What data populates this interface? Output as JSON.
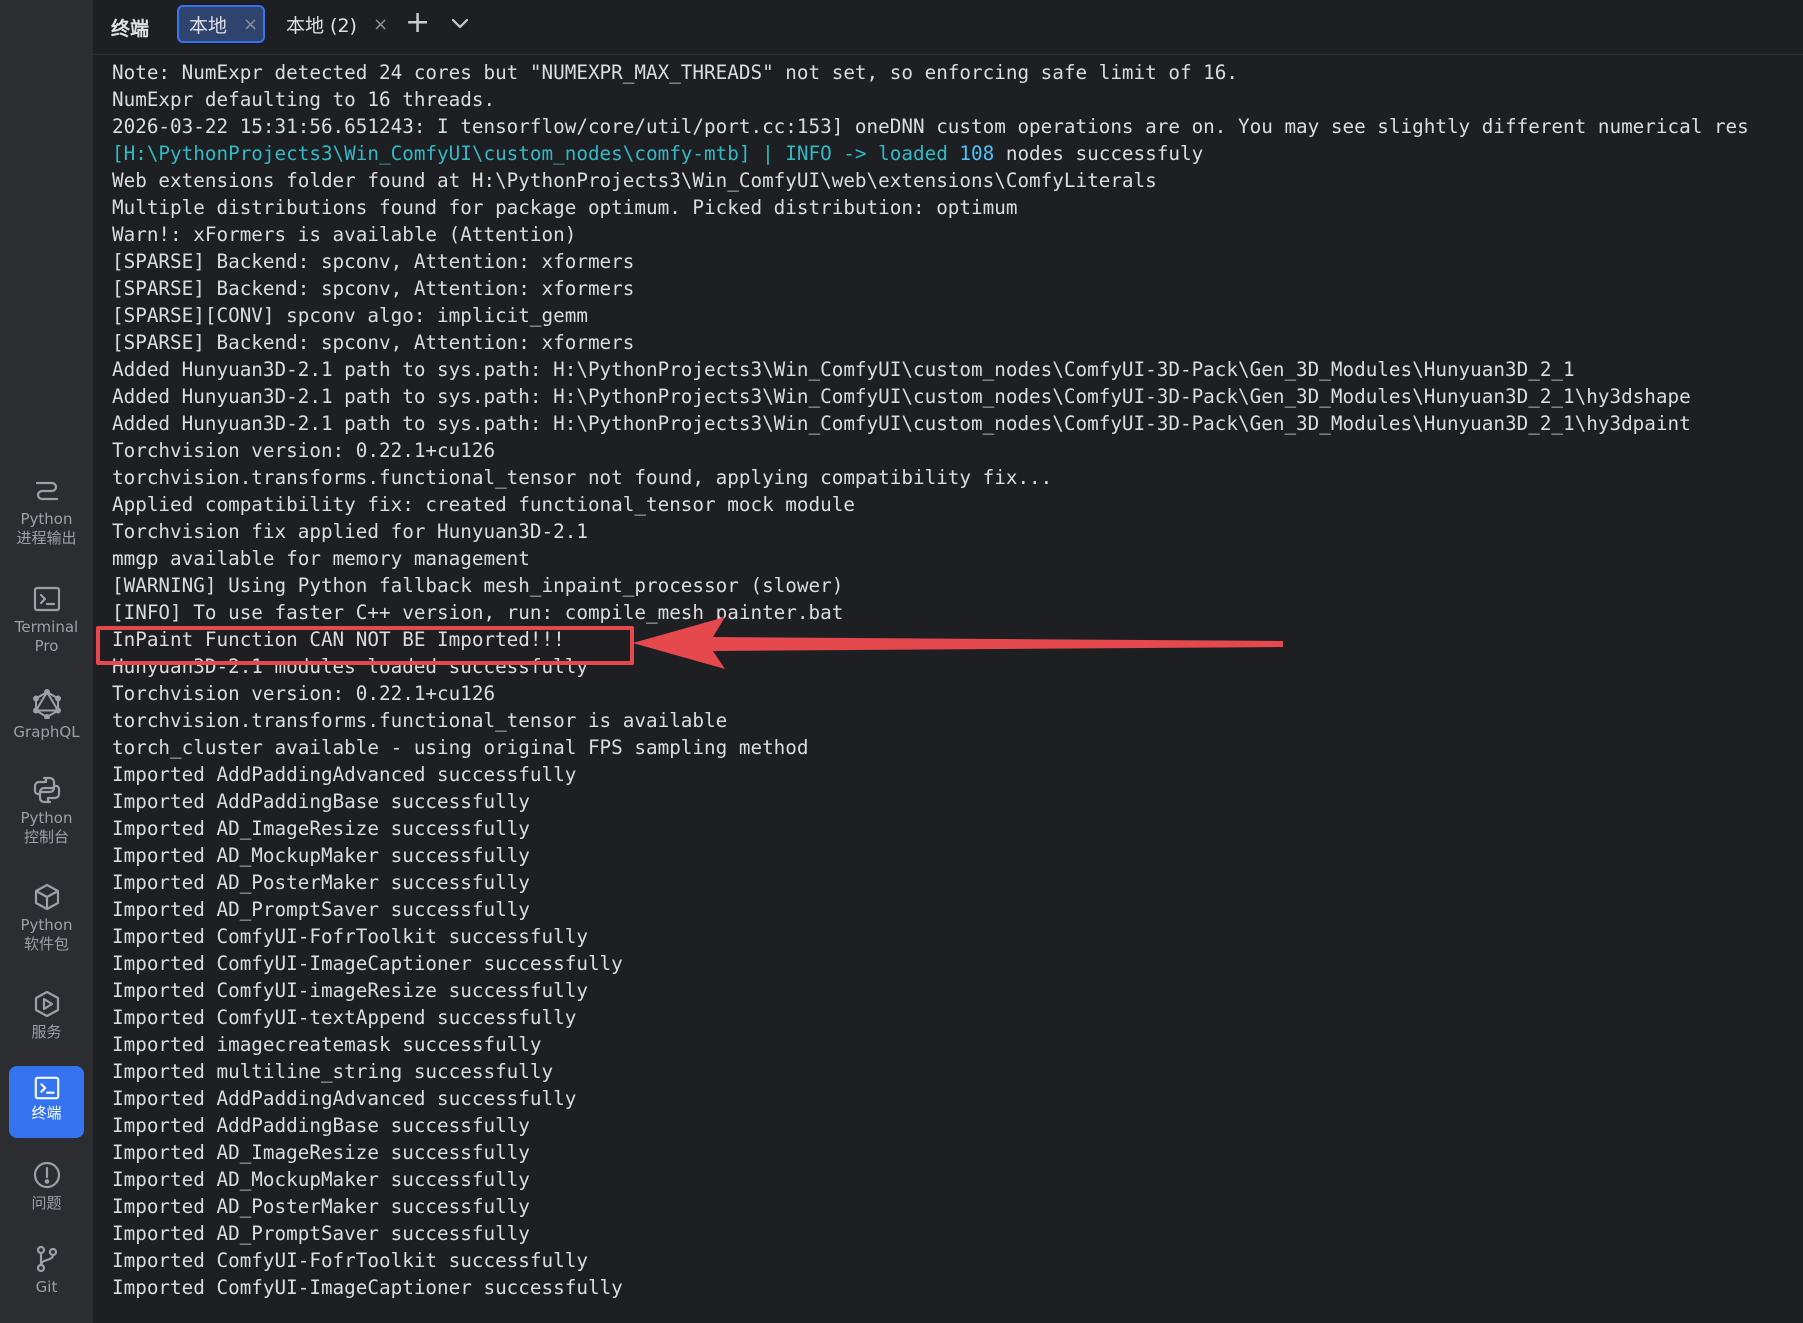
{
  "sidebar": {
    "items": [
      {
        "label": "Python\n进程输出",
        "icon": "python-output-icon"
      },
      {
        "label": "Terminal\nPro",
        "icon": "terminal-pro-icon"
      },
      {
        "label": "GraphQL",
        "icon": "graphql-icon"
      },
      {
        "label": "Python\n控制台",
        "icon": "python-console-icon"
      },
      {
        "label": "Python\n软件包",
        "icon": "python-packages-icon"
      },
      {
        "label": "服务",
        "icon": "services-icon"
      },
      {
        "label": "终端",
        "icon": "terminal-icon",
        "active": true
      },
      {
        "label": "问题",
        "icon": "problems-icon"
      },
      {
        "label": "Git",
        "icon": "git-icon"
      }
    ]
  },
  "tabbar": {
    "title": "终端",
    "tabs": [
      {
        "label": "本地",
        "close": "×",
        "active": true
      },
      {
        "label": "本地 (2)",
        "close": "×",
        "active": false
      }
    ],
    "add": "+",
    "more": "chevron-down-icon"
  },
  "console": {
    "lines": [
      "Note: NumExpr detected 24 cores but \"NUMEXPR_MAX_THREADS\" not set, so enforcing safe limit of 16.",
      "NumExpr defaulting to 16 threads.",
      "2026-03-22 15:31:56.651243: I tensorflow/core/util/port.cc:153] oneDNN custom operations are on. You may see slightly different numerical res",
      "",
      "Web extensions folder found at H:\\PythonProjects3\\Win_ComfyUI\\web\\extensions\\ComfyLiterals",
      "Multiple distributions found for package optimum. Picked distribution: optimum",
      "Warn!: xFormers is available (Attention)",
      "[SPARSE] Backend: spconv, Attention: xformers",
      "[SPARSE] Backend: spconv, Attention: xformers",
      "[SPARSE][CONV] spconv algo: implicit_gemm",
      "[SPARSE] Backend: spconv, Attention: xformers",
      "Added Hunyuan3D-2.1 path to sys.path: H:\\PythonProjects3\\Win_ComfyUI\\custom_nodes\\ComfyUI-3D-Pack\\Gen_3D_Modules\\Hunyuan3D_2_1",
      "Added Hunyuan3D-2.1 path to sys.path: H:\\PythonProjects3\\Win_ComfyUI\\custom_nodes\\ComfyUI-3D-Pack\\Gen_3D_Modules\\Hunyuan3D_2_1\\hy3dshape",
      "Added Hunyuan3D-2.1 path to sys.path: H:\\PythonProjects3\\Win_ComfyUI\\custom_nodes\\ComfyUI-3D-Pack\\Gen_3D_Modules\\Hunyuan3D_2_1\\hy3dpaint",
      "Torchvision version: 0.22.1+cu126",
      "torchvision.transforms.functional_tensor not found, applying compatibility fix...",
      "Applied compatibility fix: created functional_tensor mock module",
      "Torchvision fix applied for Hunyuan3D-2.1",
      "mmgp available for memory management",
      "[WARNING] Using Python fallback mesh_inpaint_processor (slower)",
      "[INFO] To use faster C++ version, run: compile_mesh_painter.bat",
      "InPaint Function CAN NOT BE Imported!!!",
      "Hunyuan3D-2.1 modules loaded successfully",
      "Torchvision version: 0.22.1+cu126",
      "torchvision.transforms.functional_tensor is available",
      "torch_cluster available - using original FPS sampling method",
      "Imported AddPaddingAdvanced successfully",
      "Imported AddPaddingBase successfully",
      "Imported AD_ImageResize successfully",
      "Imported AD_MockupMaker successfully",
      "Imported AD_PosterMaker successfully",
      "Imported AD_PromptSaver successfully",
      "Imported ComfyUI-FofrToolkit successfully",
      "Imported ComfyUI-ImageCaptioner successfully",
      "Imported ComfyUI-imageResize successfully",
      "Imported ComfyUI-textAppend successfully",
      "Imported imagecreatemask successfully",
      "Imported multiline_string successfully",
      "Imported AddPaddingAdvanced successfully",
      "Imported AddPaddingBase successfully",
      "Imported AD_ImageResize successfully",
      "Imported AD_MockupMaker successfully",
      "Imported AD_PosterMaker successfully",
      "Imported AD_PromptSaver successfully",
      "Imported ComfyUI-FofrToolkit successfully",
      "Imported ComfyUI-ImageCaptioner successfully"
    ],
    "mtb_line": {
      "prefix": "[H:\\PythonProjects3\\Win_ComfyUI\\custom_nodes\\comfy-mtb] | INFO -> loaded ",
      "count": "108",
      "suffix": " nodes successfuly"
    },
    "highlighted_line": "InPaint Function CAN NOT BE Imported!!!",
    "accent_colors": {
      "highlight": "#e5484d",
      "path_text": "#2fbac6",
      "active_tab": "#3574f0"
    }
  }
}
